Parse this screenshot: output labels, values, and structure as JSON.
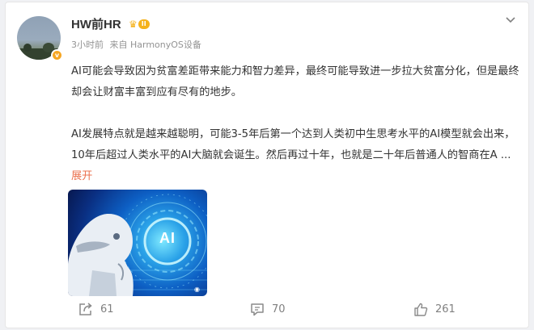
{
  "post": {
    "user": {
      "name": "HW前HR",
      "member_level": "II"
    },
    "meta": {
      "time": "3小时前",
      "source": "来自 HarmonyOS设备"
    },
    "text": {
      "para1": "AI可能会导致因为贫富差距带来能力和智力差异，最终可能导致进一步拉大贫富分化，但是最终却会让财富丰富到应有尽有的地步。",
      "para2": "AI发展特点就是越来越聪明，可能3-5年后第一个达到人类初中生思考水平的AI模型就会出来，10年后超过人类水平的AI大脑就会诞生。然后再过十年，也就是二十年后普通人的智商在A",
      "ellipsis": " ... ",
      "expand_label": "展开"
    },
    "image": {
      "label": "AI"
    },
    "actions": {
      "share_count": "61",
      "comment_count": "70",
      "like_count": "261"
    }
  },
  "colors": {
    "accent": "#eb7350",
    "meta_gray": "#939393",
    "icon_gray": "#808080",
    "gold": "#f5b21b"
  }
}
